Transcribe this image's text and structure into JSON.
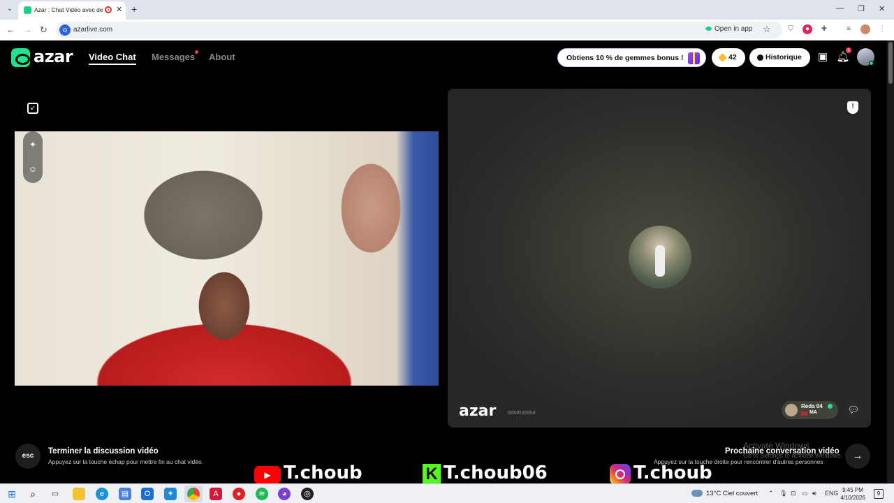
{
  "browser": {
    "tab_title": "Azar : Chat Vidéo avec de n",
    "url": "azarlive.com",
    "open_in_app": "Open in app"
  },
  "header": {
    "logo": "azar",
    "nav": [
      {
        "label": "Video Chat",
        "active": true
      },
      {
        "label": "Messages",
        "active": false,
        "has_dot": true
      },
      {
        "label": "About",
        "active": false
      }
    ],
    "bonus_label": "Obtiens 10 % de gemmes bonus !",
    "gems_count": "42",
    "history_label": "Historique",
    "notification_badge": "1"
  },
  "video": {
    "peer_logo": "azar",
    "peer_id": "3hfMR459hd",
    "peer_name": "Reda 04",
    "peer_country": "MA"
  },
  "controls": {
    "esc_label": "esc",
    "end_title": "Terminer la discussion vidéo",
    "end_subtitle": "Appuyez sur la touche échap pour mettre fin au chat vidéo.",
    "next_title": "Prochaine conversation vidéo",
    "next_subtitle": "Appuyez sur la touche droite pour rencontrer d'autres personnes"
  },
  "watermark": {
    "line1": "Activate Windows",
    "line2": "Go to Settings to activate Windows."
  },
  "overlay": {
    "youtube": "T.choub",
    "kick": "T.choub06",
    "instagram": "T.choub"
  },
  "taskbar": {
    "weather": "13°C  Ciel couvert",
    "lang": "ENG",
    "time": "9:45 PM",
    "date": "4/10/2026"
  },
  "colors": {
    "brand_green": "#1ee38f",
    "badge_red": "#ff3b5c"
  }
}
